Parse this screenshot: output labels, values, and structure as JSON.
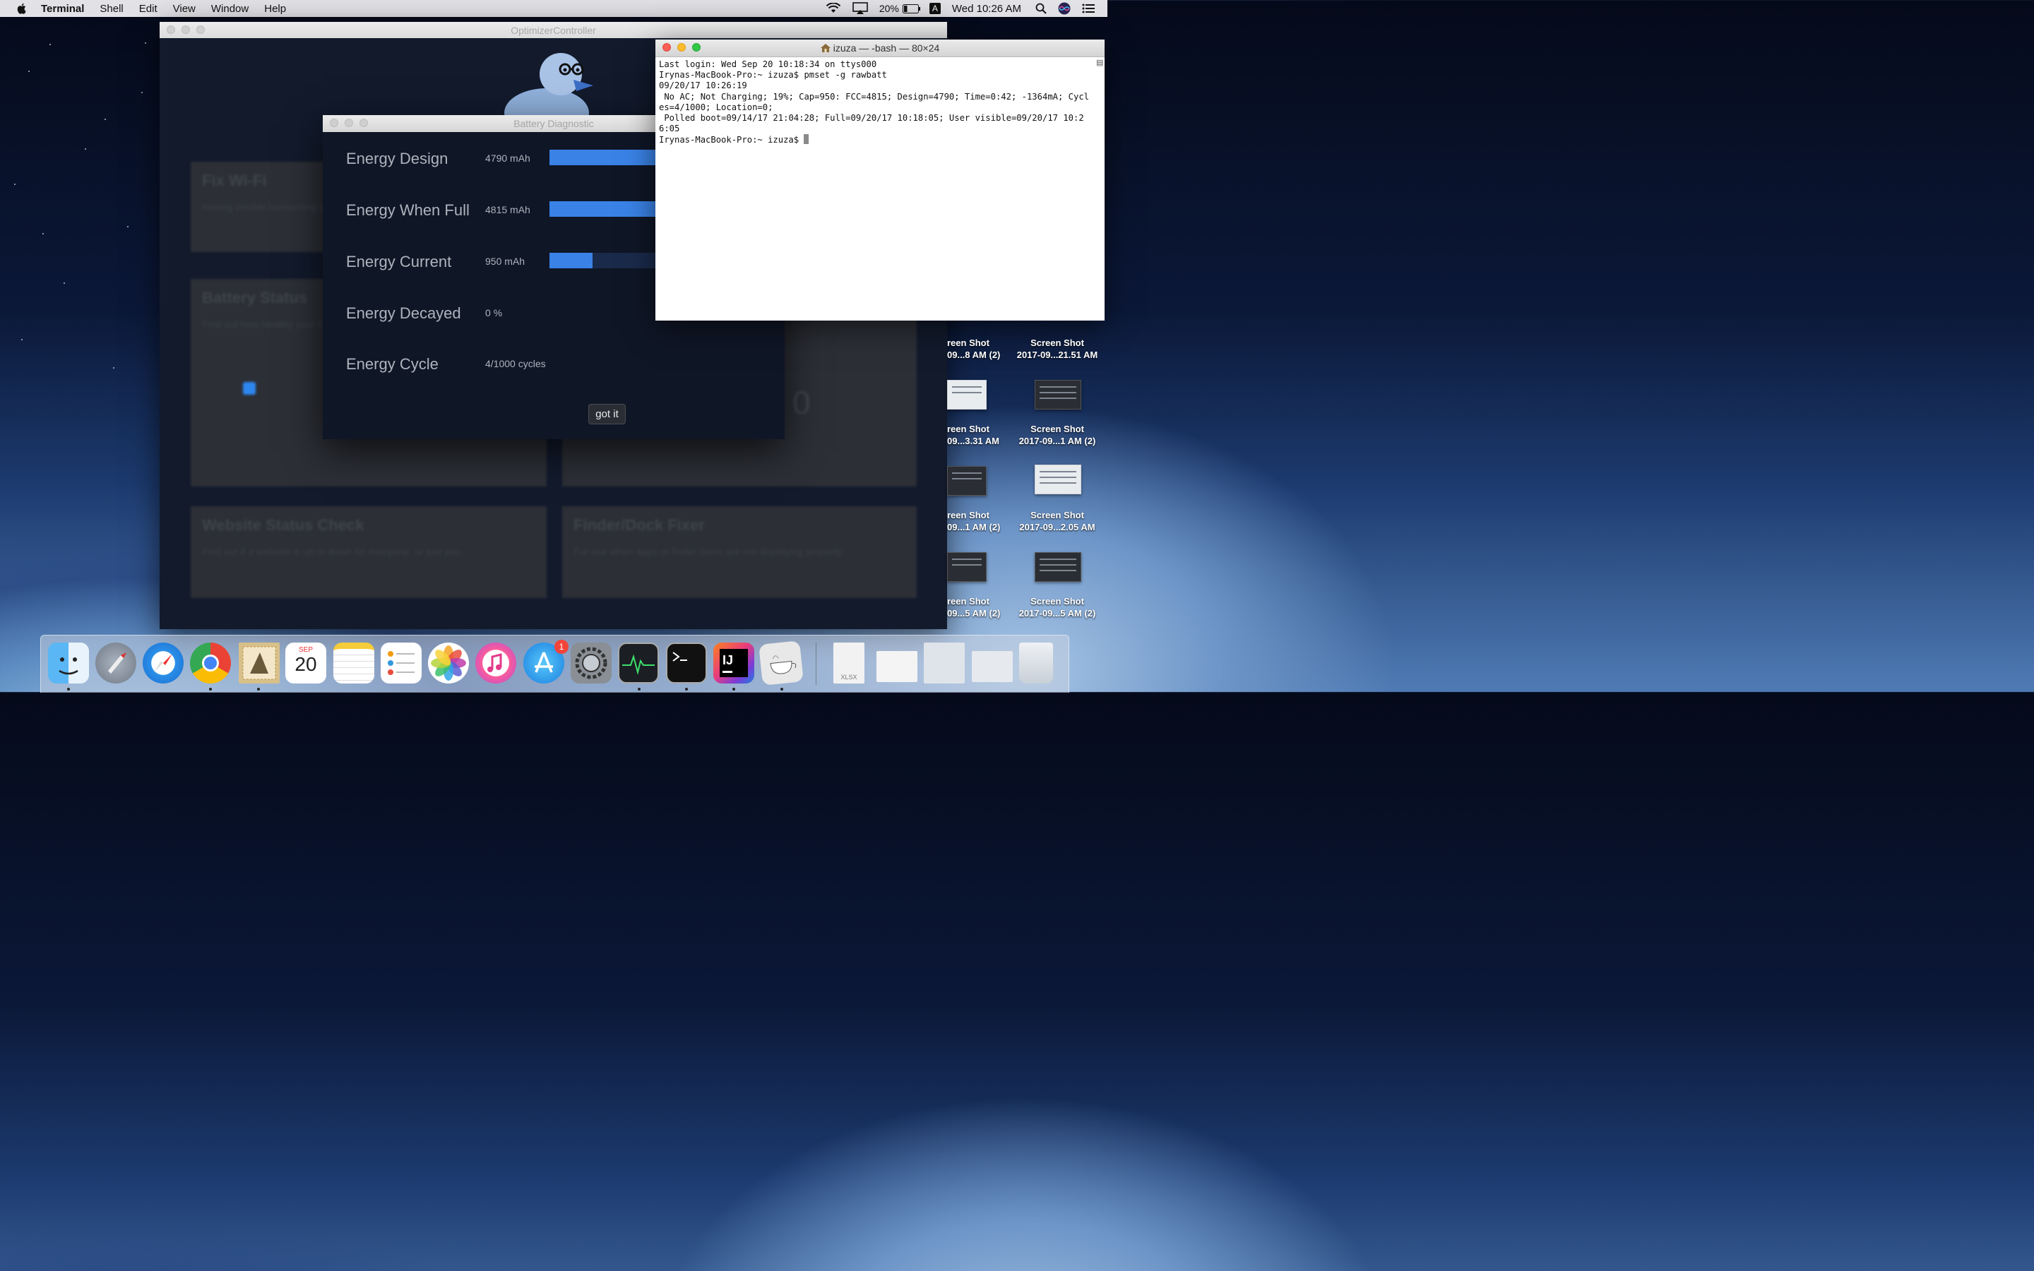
{
  "menubar": {
    "app_name": "Terminal",
    "menus": [
      "Shell",
      "Edit",
      "View",
      "Window",
      "Help"
    ],
    "battery_percent": "20%",
    "input_source": "A",
    "clock": "Wed 10:26 AM"
  },
  "optimizer": {
    "title": "OptimizerController",
    "cards": [
      {
        "title": "Fix Wi-Fi",
        "desc": "Having trouble connecting to Wi-Fi?"
      },
      {
        "title": "Battery Status",
        "desc": "Find out how healthy your battery is"
      },
      {
        "title": "Website Status Check",
        "desc": "Find out if a website is up or down for everyone, or just you."
      },
      {
        "title": "Finder/Dock Fixer",
        "desc": "For use when apps or finder items are not displaying properly."
      }
    ],
    "gauge_value": "0"
  },
  "battery_diagnostic": {
    "title": "Battery Diagnostic",
    "rows": [
      {
        "label": "Energy Design",
        "value": "4790 mAh",
        "level": 1.0
      },
      {
        "label": "Energy When Full",
        "value": "4815 mAh",
        "level": 1.0
      },
      {
        "label": "Energy Current",
        "value": "950 mAh",
        "level": 0.19
      },
      {
        "label": "Energy Decayed",
        "value": "0 %"
      },
      {
        "label": "Energy Cycle",
        "value": "4/1000 cycles"
      }
    ],
    "button_label": "got it"
  },
  "terminal": {
    "title": "izuza — -bash — 80×24",
    "output": "Last login: Wed Sep 20 10:18:34 on ttys000\nIrynas-MacBook-Pro:~ izuza$ pmset -g rawbatt\n09/20/17 10:26:19\n No AC; Not Charging; 19%; Cap=950: FCC=4815; Design=4790; Time=0:42; -1364mA; Cycles=4/1000; Location=0;\n Polled boot=09/14/17 21:04:28; Full=09/20/17 10:18:05; User visible=09/20/17 10:26:05\nIrynas-MacBook-Pro:~ izuza$ "
  },
  "desktop": {
    "icons": [
      {
        "line1": "Screen Shot",
        "line2": "2017-09...21.51 AM"
      },
      {
        "line1": "Screen Shot",
        "line2": "2017-09...1 AM (2)"
      },
      {
        "line1": "Screen Shot",
        "line2": "2017-09...2.05 AM"
      },
      {
        "line1": "Screen Shot",
        "line2": "2017-09...5 AM (2)"
      },
      {
        "line1": "reen Shot",
        "line2": "09...8 AM (2)"
      },
      {
        "line1": "reen Shot",
        "line2": "09...3.31 AM"
      },
      {
        "line1": "reen Shot",
        "line2": "09...1 AM (2)"
      },
      {
        "line1": "reen Shot",
        "line2": "09...5 AM (2)"
      }
    ]
  },
  "dock": {
    "calendar_month": "SEP",
    "calendar_day": "20",
    "appstore_badge": "1",
    "intellij_label": "IJ",
    "doc_label": "XLSX"
  }
}
